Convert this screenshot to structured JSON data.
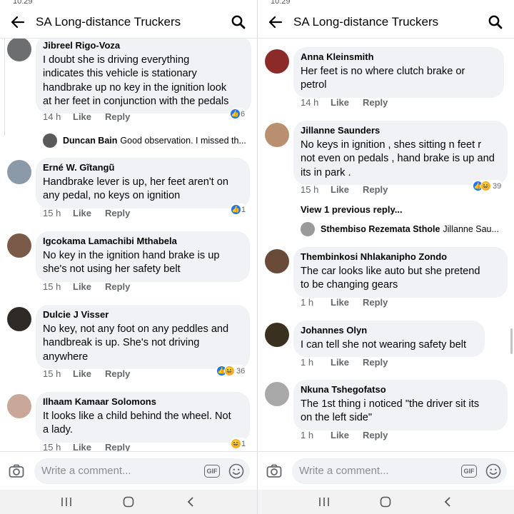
{
  "left": {
    "status_time": "10:29",
    "title": "SA Long-distance Truckers",
    "comments": [
      {
        "name": "Jibreel Rigo-Voza",
        "lines": [
          "I doubt she is driving everything",
          "indicates this vehicle is stationary",
          "handbrake up no key in the ignition look",
          "at her feet in conjunction with the pedals"
        ],
        "time": "14 h",
        "like": "Like",
        "reply": "Reply",
        "reaction_count": "6",
        "avatar_color": "#6d6e70"
      },
      {
        "name": "Erné W. Gĩtangũ",
        "lines": [
          "Handbrake lever is up, her feet aren't on",
          "any pedal, no keys on ignition"
        ],
        "time": "15 h",
        "like": "Like",
        "reply": "Reply",
        "reaction_count": "1",
        "avatar_color": "#8a9aa8"
      },
      {
        "name": "Igcokama Lamachibi Mthabela",
        "lines": [
          "No key in the ignition hand brake is up",
          "she's not using her safety belt"
        ],
        "time": "15 h",
        "like": "Like",
        "reply": "Reply",
        "avatar_color": "#7a5a48"
      },
      {
        "name": "Dulcie J Visser",
        "lines": [
          "No key, not any foot on any peddles  and",
          "handbreak is up. She's not driving",
          "anywhere"
        ],
        "time": "15 h",
        "like": "Like",
        "reply": "Reply",
        "reaction_count": "36",
        "avatar_color": "#2e2a26"
      },
      {
        "name": "Ilhaam Kamaar Solomons",
        "lines": [
          "It looks like a child behind the wheel. Not",
          "a lady."
        ],
        "time": "15 h",
        "like": "Like",
        "reply": "Reply",
        "reaction_count": "1",
        "avatar_color": "#c9a89a"
      }
    ],
    "reply_preview": {
      "name": "Duncan Bain",
      "text": "Good observation. I missed th..."
    }
  },
  "right": {
    "status_time": "10:29",
    "title": "SA Long-distance Truckers",
    "comments": [
      {
        "name": "Anna Kleinsmith",
        "lines": [
          "Her feet is no where clutch brake or",
          "petrol"
        ],
        "time": "14 h",
        "like": "Like",
        "reply": "Reply",
        "avatar_color": "#8c2a2a"
      },
      {
        "name": "Jillanne Saunders",
        "lines": [
          "No keys in ignition , shes sitting n feet r",
          "not even on pedals , hand brake is up and",
          "its in park ."
        ],
        "time": "15 h",
        "like": "Like",
        "reply": "Reply",
        "reaction_count": "39",
        "avatar_color": "#b89070"
      },
      {
        "name": "Thembinkosi Nhlakanipho Zondo",
        "lines": [
          "The car looks like auto but she pretend",
          "to be changing gears"
        ],
        "time": "1 h",
        "like": "Like",
        "reply": "Reply",
        "avatar_color": "#6a4a38"
      },
      {
        "name": "Johannes Olyn",
        "lines": [
          "I can tell she not wearing safety belt"
        ],
        "time": "1 h",
        "like": "Like",
        "reply": "Reply",
        "avatar_color": "#3a3020"
      },
      {
        "name": "Nkuna Tshegofatso",
        "lines": [
          "The 1st thing i noticed \"the driver sit its",
          "on the left side\""
        ],
        "time": "1 h",
        "like": "Like",
        "reply": "Reply",
        "avatar_color": "#a8a8a8"
      }
    ],
    "view_previous": "View 1 previous reply...",
    "reply_preview": {
      "name": "Sthembiso Rezemata Sthole",
      "text": "Jillanne Sau..."
    }
  },
  "composer": {
    "placeholder": "Write a comment...",
    "gif_label": "GIF"
  },
  "colors": {
    "like_blue": "#1877f2",
    "haha_yellow": "#f7b125",
    "bubble": "#f0f2f5"
  }
}
